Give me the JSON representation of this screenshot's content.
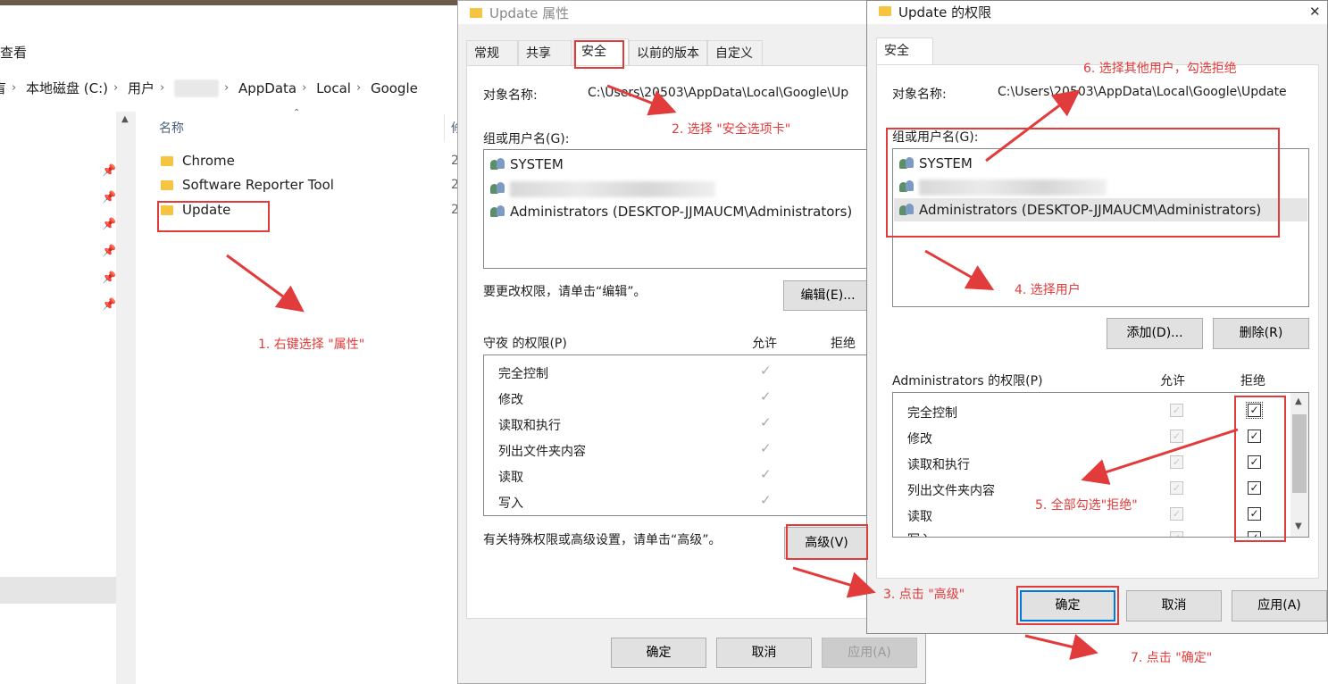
{
  "explorer": {
    "menu_view": "查看",
    "breadcrumb": [
      "本地磁盘 (C:)",
      "用户",
      "AppData",
      "Local",
      "Google"
    ],
    "breadcrumb_lead": "盲",
    "column_name": "名称",
    "column_cut": "修",
    "files": [
      {
        "name": "Chrome",
        "date_cut": "2"
      },
      {
        "name": "Software Reporter Tool",
        "date_cut": "2"
      },
      {
        "name": "Update",
        "date_cut": "2"
      }
    ]
  },
  "props": {
    "title": "Update 属性",
    "tabs": [
      "常规",
      "共享",
      "安全",
      "以前的版本",
      "自定义"
    ],
    "object_label": "对象名称:",
    "object_value": "C:\\Users\\20503\\AppData\\Local\\Google\\Up",
    "group_label": "组或用户名(G):",
    "users": [
      "SYSTEM",
      "",
      "Administrators (DESKTOP-JJMAUCM\\Administrators)"
    ],
    "edit_hint": "要更改权限，请单击“编辑”。",
    "edit_button": "编辑(E)...",
    "perm_header": "守夜 的权限(P)",
    "allow_header": "允许",
    "deny_header": "拒绝",
    "permissions": [
      "完全控制",
      "修改",
      "读取和执行",
      "列出文件夹内容",
      "读取",
      "写入"
    ],
    "advanced_hint": "有关特殊权限或高级设置，请单击“高级”。",
    "advanced_button": "高级(V)",
    "ok": "确定",
    "cancel": "取消",
    "apply": "应用(A)"
  },
  "perms": {
    "title": "Update 的权限",
    "tab": "安全",
    "object_label": "对象名称:",
    "object_value": "C:\\Users\\20503\\AppData\\Local\\Google\\Update",
    "group_label": "组或用户名(G):",
    "users": [
      "SYSTEM",
      "",
      "Administrators (DESKTOP-JJMAUCM\\Administrators)"
    ],
    "add_button": "添加(D)...",
    "remove_button": "删除(R)",
    "perm_header": "Administrators 的权限(P)",
    "allow_header": "允许",
    "deny_header": "拒绝",
    "permissions": [
      "完全控制",
      "修改",
      "读取和执行",
      "列出文件夹内容",
      "读取",
      "写入"
    ],
    "ok": "确定",
    "cancel": "取消",
    "apply": "应用(A)",
    "close_glyph": "✕"
  },
  "annotations": {
    "step1": "1. 右键选择 \"属性\"",
    "step2": "2. 选择 \"安全选项卡\"",
    "step3": "3. 点击 \"高级\"",
    "step4": "4. 选择用户",
    "step5": "5. 全部勾选\"拒绝\"",
    "step6": "6. 选择其他用户，勾选拒绝",
    "step7": "7. 点击 \"确定\""
  },
  "colors": {
    "annotation_red": "#e23b3b",
    "focus_blue": "#0078d7",
    "folder": "#f5c542"
  }
}
